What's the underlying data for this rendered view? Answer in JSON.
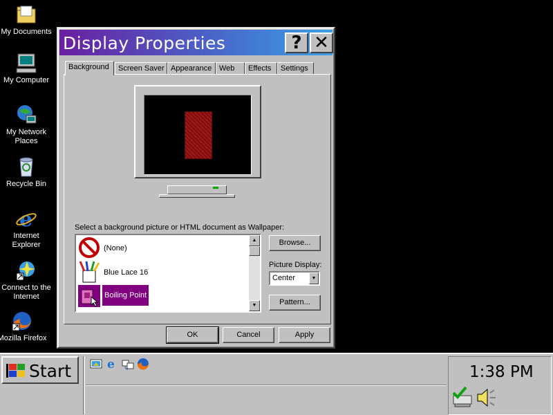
{
  "desktop": {
    "icons": [
      {
        "label": "My Documents",
        "icon": "folder-icon"
      },
      {
        "label": "My Computer",
        "icon": "computer-icon"
      },
      {
        "label": "My Network Places",
        "icon": "network-icon"
      },
      {
        "label": "Recycle Bin",
        "icon": "recycle-bin-icon"
      },
      {
        "label": "Internet Explorer",
        "icon": "ie-icon"
      },
      {
        "label": "Connect to the Internet",
        "icon": "connect-icon"
      },
      {
        "label": "Mozilla Firefox",
        "icon": "firefox-icon"
      }
    ]
  },
  "window": {
    "title": "Display Properties",
    "help_label": "?",
    "close_label": "✕",
    "tabs": [
      "Background",
      "Screen Saver",
      "Appearance",
      "Web",
      "Effects",
      "Settings"
    ],
    "active_tab": "Background",
    "prompt": "Select a background picture or HTML document as Wallpaper:",
    "wallpapers": [
      {
        "label": "(None)",
        "icon": "none-icon"
      },
      {
        "label": "Blue Lace 16",
        "icon": "paint-icon"
      },
      {
        "label": "Boiling Point",
        "icon": "image-icon"
      }
    ],
    "selected_wallpaper": "Boiling Point",
    "browse_label": "Browse...",
    "picture_display_label": "Picture Display:",
    "picture_display_value": "Center",
    "pattern_label": "Pattern...",
    "ok_label": "OK",
    "cancel_label": "Cancel",
    "apply_label": "Apply"
  },
  "taskbar": {
    "start_label": "Start",
    "quick_launch": [
      "desktop-icon",
      "ie-icon",
      "channels-icon",
      "firefox-icon"
    ],
    "clock": "1:38 PM",
    "tray_icons": [
      "network-tray-icon",
      "volume-icon"
    ]
  },
  "colors": {
    "selection": "#800080",
    "title_start": "#6a1fa0",
    "title_end": "#3aa0e6",
    "face": "#c0c0c0"
  }
}
